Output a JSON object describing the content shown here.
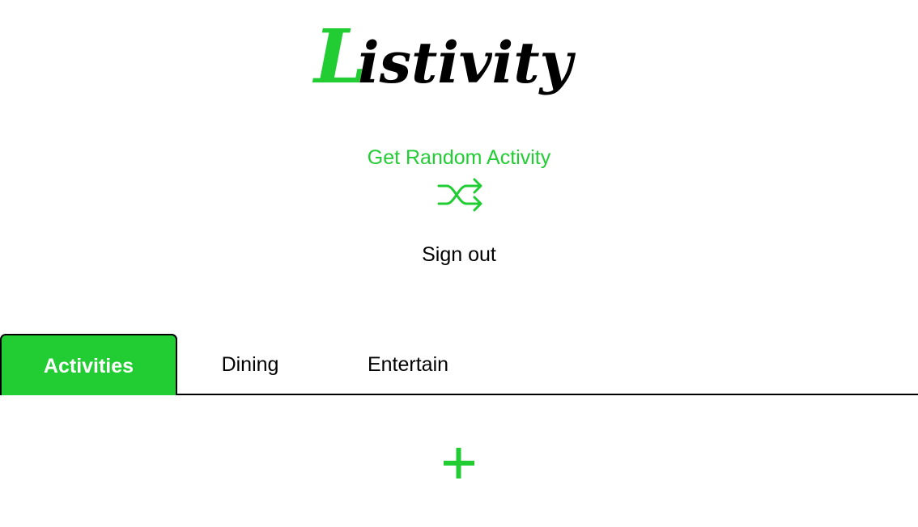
{
  "app": {
    "logo_text": "Listivity",
    "logo_first_letter": "L",
    "logo_rest": "istivity"
  },
  "random": {
    "label": "Get Random Activity",
    "icon": "shuffle-icon"
  },
  "auth": {
    "signout_label": "Sign out"
  },
  "tabs": [
    {
      "label": "Activities",
      "active": true
    },
    {
      "label": "Dining",
      "active": false
    },
    {
      "label": "Entertain",
      "active": false
    }
  ],
  "add": {
    "icon": "plus-icon"
  },
  "colors": {
    "accent": "#22cc33",
    "text": "#000000",
    "background": "#ffffff"
  }
}
